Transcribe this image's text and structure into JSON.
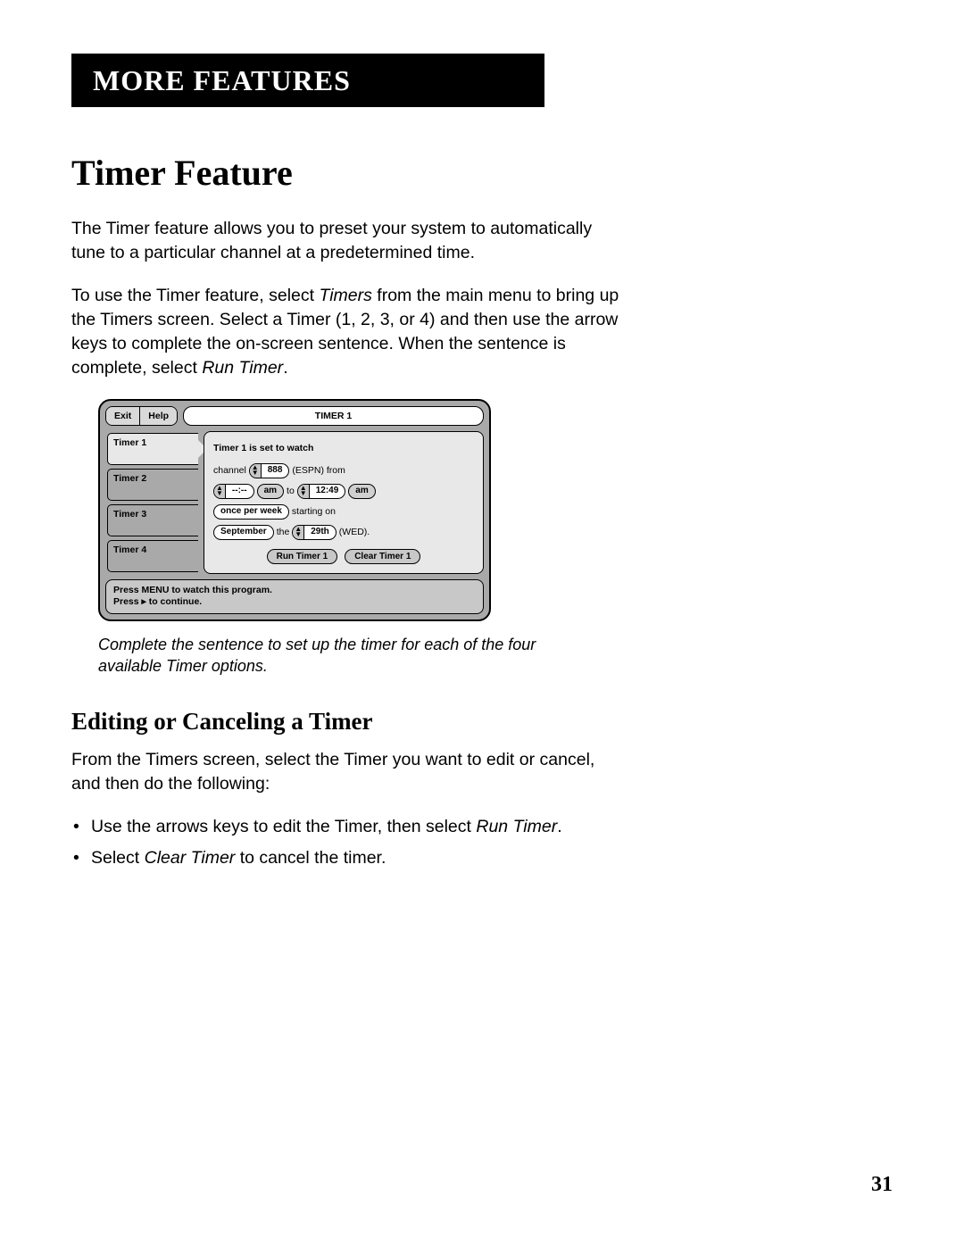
{
  "header": {
    "label": "MORE FEATURES"
  },
  "title": "Timer Feature",
  "intro_p1": "The Timer feature allows you to preset your system to automatically tune to a particular channel at a predetermined time.",
  "intro_p2_pre": "To use the Timer feature, select ",
  "intro_p2_italic1": "Timers",
  "intro_p2_mid": " from the main menu to bring up the Timers screen.  Select a Timer (1, 2, 3, or 4) and then use the arrow keys to complete the on-screen sentence. When the sentence is complete, select ",
  "intro_p2_italic2": "Run Timer",
  "intro_p2_post": ".",
  "osd": {
    "exit": "Exit",
    "help": "Help",
    "title": "TIMER 1",
    "tabs": [
      "Timer 1",
      "Timer 2",
      "Timer 3",
      "Timer 4"
    ],
    "line1": "Timer 1 is set to watch",
    "word_channel": "channel",
    "channel_num": "888",
    "channel_name": "(ESPN) from",
    "time_from": "--:--",
    "ampm1": "am",
    "word_to": "to",
    "time_to": "12:49",
    "ampm2": "am",
    "freq": "once per week",
    "word_starting": "starting on",
    "month": "September",
    "word_the": "the",
    "day": "29th",
    "dow": "(WED).",
    "run_btn": "Run Timer 1",
    "clear_btn": "Clear Timer 1",
    "footer_l1": "Press MENU to watch this program.",
    "footer_l2": "Press ▸ to continue."
  },
  "caption": "Complete the sentence to set up the timer for each of the four available Timer options.",
  "sub_title": "Editing or Canceling a Timer",
  "sub_intro": "From the Timers screen, select the Timer you want to edit or cancel, and then do the following:",
  "bullet1_pre": "Use the arrows keys to edit the Timer, then select ",
  "bullet1_italic": "Run Timer",
  "bullet1_post": ".",
  "bullet2_pre": "Select ",
  "bullet2_italic": "Clear Timer",
  "bullet2_post": " to cancel the timer.",
  "page_number": "31"
}
